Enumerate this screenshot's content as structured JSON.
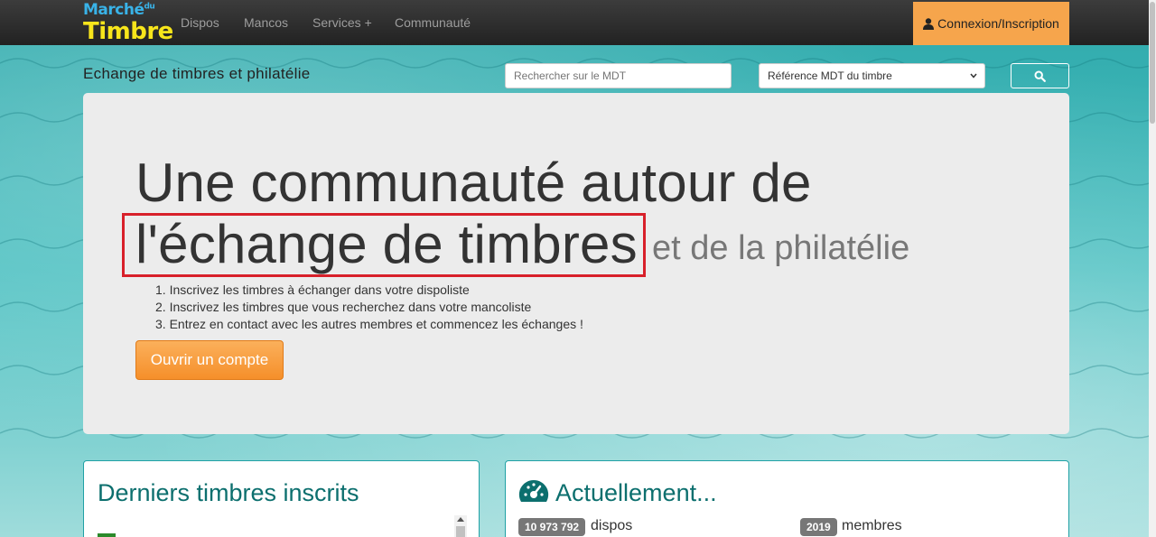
{
  "nav": {
    "logo_line1": "Marché",
    "logo_sup": "du",
    "logo_line2": "Timbre",
    "links": [
      "Dispos",
      "Mancos",
      "Services +",
      "Communauté"
    ],
    "login": "Connexion/Inscription"
  },
  "header": {
    "tagline": "Echange de timbres et philatélie",
    "search_placeholder": "Rechercher sur le MDT",
    "select_value": "Référence MDT du timbre"
  },
  "hero": {
    "line1": "Une communauté autour de",
    "line2": "l'échange de timbres",
    "line3": "et de la philatélie",
    "steps": [
      "1. Inscrivez les timbres à échanger dans votre dispoliste",
      "2. Inscrivez les timbres que vous recherchez dans votre mancoliste",
      "3. Entrez en contact avec les autres membres et commencez les échanges !"
    ],
    "cta": "Ouvrir un compte"
  },
  "panels": {
    "latest_title": "Derniers timbres inscrits",
    "now_title": "Actuellement...",
    "stats": [
      {
        "count": "10 973 792",
        "label": "dispos"
      },
      {
        "count": "2019",
        "label": "membres"
      }
    ]
  },
  "colors": {
    "accent_orange": "#f6a54c",
    "teal": "#35b6b8",
    "highlight_red": "#d8202a"
  }
}
